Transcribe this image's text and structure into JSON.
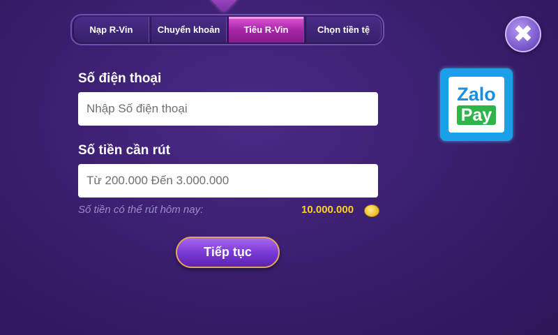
{
  "tabs": [
    {
      "label": "Nạp R-Vin",
      "active": false
    },
    {
      "label": "Chuyển khoản",
      "active": false
    },
    {
      "label": "Tiêu R-Vin",
      "active": true
    },
    {
      "label": "Chọn tiền tệ",
      "active": false
    }
  ],
  "close": {
    "icon": "close-icon",
    "glyph": "✖"
  },
  "form": {
    "phone_label": "Số điện thoại",
    "phone_placeholder": "Nhập Số điện thoại",
    "amount_label": "Số tiền cần rút",
    "amount_placeholder": "Từ 200.000 Đến 3.000.000",
    "hint_text": "Số tiền có thể rút hôm nay:",
    "available_amount": "10.000.000"
  },
  "buttons": {
    "continue_label": "Tiếp tục"
  },
  "payment_logo": {
    "line1": "Zalo",
    "line2": "Pay"
  },
  "colors": {
    "accent": "#d34fd1",
    "amount": "#ffd21f",
    "zalo_blue": "#19a0e8",
    "zalo_green": "#2fb44a"
  }
}
